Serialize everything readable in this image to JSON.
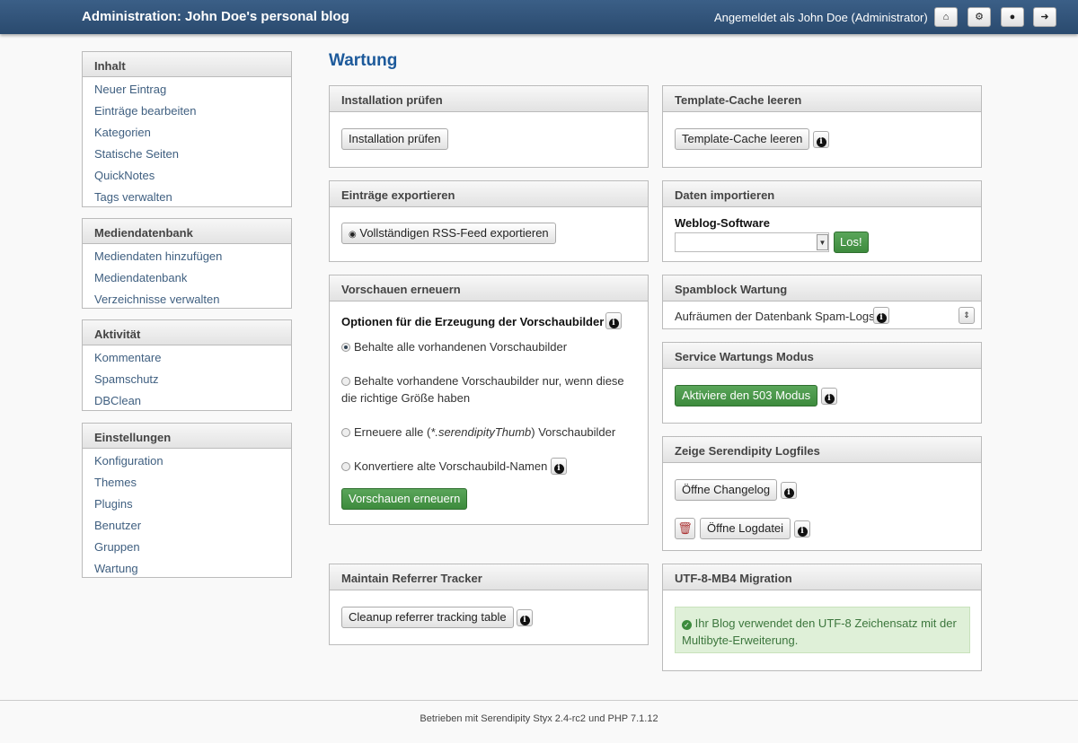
{
  "header": {
    "title": "Administration: John Doe's personal blog",
    "user": "Angemeldet als John Doe (Administrator)",
    "icons": [
      "home-icon",
      "cogs-icon",
      "globe-icon",
      "logout-icon"
    ]
  },
  "sidebar": [
    {
      "title": "Inhalt",
      "items": [
        "Neuer Eintrag",
        "Einträge bearbeiten",
        "Kategorien",
        "Statische Seiten",
        "QuickNotes",
        "Tags verwalten"
      ]
    },
    {
      "title": "Mediendatenbank",
      "items": [
        "Mediendaten hinzufügen",
        "Mediendatenbank",
        "Verzeichnisse verwalten"
      ]
    },
    {
      "title": "Aktivität",
      "items": [
        "Kommentare",
        "Spamschutz",
        "DBClean"
      ]
    },
    {
      "title": "Einstellungen",
      "items": [
        "Konfiguration",
        "Themes",
        "Plugins",
        "Benutzer",
        "Gruppen",
        "Wartung"
      ]
    }
  ],
  "page_title": "Wartung",
  "panels": {
    "install": {
      "title": "Installation prüfen",
      "button": "Installation prüfen"
    },
    "export": {
      "title": "Einträge exportieren",
      "button": "Vollständigen RSS-Feed exportieren"
    },
    "thumbs": {
      "title": "Vorschauen erneuern",
      "heading": "Optionen für die Erzeugung der Vorschaubilder",
      "options": [
        "Behalte alle vorhandenen Vorschaubilder",
        "Behalte vorhandene Vorschaubilder nur, wenn diese",
        "die richtige Größe haben",
        "Erneuere alle (",
        "*.serendipityThumb",
        ") Vorschaubilder",
        "Konvertiere alte Vorschaubild-Namen"
      ],
      "selected": 0,
      "button": "Vorschauen erneuern"
    },
    "referrer": {
      "title": "Maintain Referrer Tracker",
      "button": "Cleanup referrer tracking table"
    },
    "template": {
      "title": "Template-Cache leeren",
      "button": "Template-Cache leeren"
    },
    "import": {
      "title": "Daten importieren",
      "label": "Weblog-Software",
      "select_value": "",
      "button": "Los!"
    },
    "spamblock": {
      "title": "Spamblock Wartung",
      "text": "Aufräumen der Datenbank Spam-Logs"
    },
    "service": {
      "title": "Service Wartungs Modus",
      "button": "Aktiviere den 503 Modus"
    },
    "logfiles": {
      "title": "Zeige Serendipity Logfiles",
      "changelog": "Öffne Changelog",
      "logfile": "Öffne Logdatei"
    },
    "utf8": {
      "title": "UTF-8-MB4 Migration",
      "message_line1": "Ihr Blog verwendet den UTF-8 Zeichensatz mit der",
      "message_line2": "Multibyte-Erweiterung."
    }
  },
  "footer": "Betrieben mit Serendipity Styx 2.4-rc2 und PHP 7.1.12"
}
